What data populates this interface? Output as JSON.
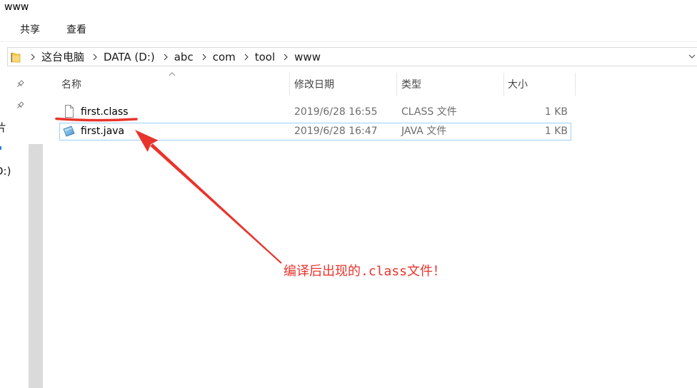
{
  "window": {
    "title": "www"
  },
  "ribbon": {
    "tabs": [
      "共享",
      "查看"
    ]
  },
  "address_bar": {
    "folder_icon": "folder-icon",
    "path": [
      "这台电脑",
      "DATA (D:)",
      "abc",
      "com",
      "tool",
      "www"
    ]
  },
  "nav_pane": {
    "pin_icon": "pin-icon",
    "visible_fragments": [
      "片",
      "D:)"
    ]
  },
  "file_list": {
    "columns": [
      "名称",
      "修改日期",
      "类型",
      "大小"
    ],
    "sort_icon": "sort-ascending-icon",
    "rows": [
      {
        "name": "first.class",
        "modified": "2019/6/28 16:55",
        "type": "CLASS 文件",
        "size": "1 KB",
        "icon": "blank-file-icon",
        "selected": false
      },
      {
        "name": "first.java",
        "modified": "2019/6/28 16:47",
        "type": "JAVA 文件",
        "size": "1 KB",
        "icon": "java-file-icon",
        "selected": true
      }
    ]
  },
  "annotation": {
    "text": "编译后出现的.class文件！",
    "arrow_icon": "red-arrow-icon"
  },
  "theme": {
    "annotation_red": "#e8342c",
    "selection_border": "#99d1ff",
    "folder_yellow": "#f3c94d",
    "detail_gray": "#6d6d6d"
  }
}
